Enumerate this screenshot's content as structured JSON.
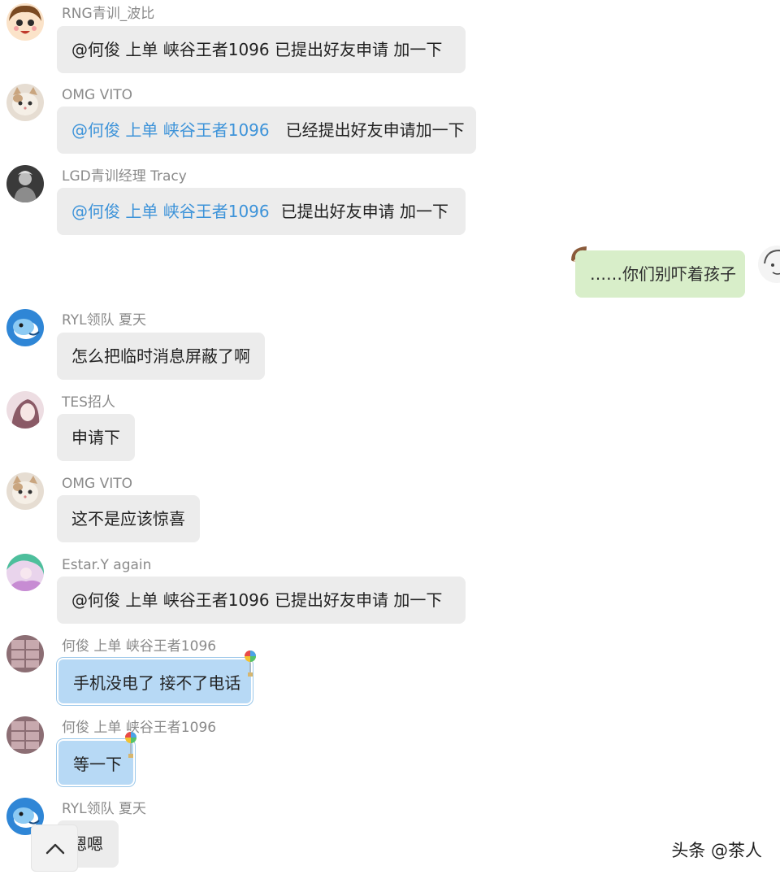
{
  "messages": [
    {
      "sender": "RNG青训_波比",
      "mention": "",
      "text": "@何俊 上单 峡谷王者1096  已提出好友申请  加一下",
      "avatar_icon": "cartoon-face-avatar"
    },
    {
      "sender": "OMG VITO",
      "mention": "@何俊 上单 峡谷王者1096",
      "text": "已经提出好友申请加一下",
      "avatar_icon": "cat-avatar"
    },
    {
      "sender": "LGD青训经理 Tracy",
      "mention": "@何俊 上单 峡谷王者1096",
      "text": "已提出好友申请  加一下",
      "avatar_icon": "gray-figure-avatar"
    },
    {
      "sender": "RYL领队 夏天",
      "mention": "",
      "text": "怎么把临时消息屏蔽了啊",
      "avatar_icon": "dolphin-avatar"
    },
    {
      "sender": "TES招人",
      "mention": "",
      "text": "申请下",
      "avatar_icon": "pink-portrait-avatar"
    },
    {
      "sender": "OMG VITO",
      "mention": "",
      "text": "这不是应该惊喜",
      "avatar_icon": "cat-avatar"
    },
    {
      "sender": "Estar.Y again",
      "mention": "",
      "text": "@何俊 上单 峡谷王者1096  已提出好友申请  加一下",
      "avatar_icon": "colorful-avatar"
    },
    {
      "sender": "何俊 上单 峡谷王者1096",
      "mention": "",
      "text": "手机没电了 接不了电话",
      "avatar_icon": "window-avatar"
    },
    {
      "sender": "何俊 上单 峡谷王者1096",
      "mention": "",
      "text": "等一下",
      "avatar_icon": "window-avatar"
    },
    {
      "sender": "RYL领队 夏天",
      "mention": "",
      "text": "嗯嗯",
      "avatar_icon": "dolphin-avatar"
    }
  ],
  "own_message": {
    "text": "……你们别吓着孩子",
    "avatar_icon": "sketch-face-avatar"
  },
  "scroll_button_icon": "chevron-up-icon",
  "watermark": "头条 @茶人",
  "colors": {
    "bubble_gray": "#ececec",
    "bubble_blue": "#b7d9f5",
    "bubble_green": "#d8eec9",
    "mention_blue": "#3d93d9",
    "sender_gray": "#8a8a8a"
  }
}
